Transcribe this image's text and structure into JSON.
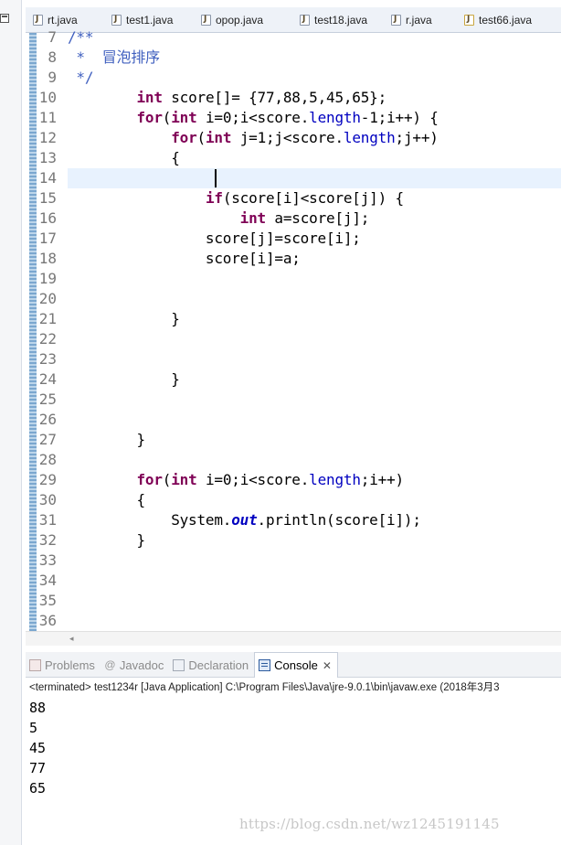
{
  "editor": {
    "tabs": [
      {
        "label": "rt.java",
        "icon": "java-file-icon"
      },
      {
        "label": "test1.java",
        "icon": "java-file-icon"
      },
      {
        "label": "opop.java",
        "icon": "java-file-icon"
      },
      {
        "label": "test18.java",
        "icon": "java-file-icon"
      },
      {
        "label": "r.java",
        "icon": "java-file-icon"
      },
      {
        "label": "test66.java",
        "icon": "java-file-warning-icon"
      }
    ],
    "current_line": 14,
    "lines": [
      {
        "n": "7",
        "tokens": [
          {
            "t": "/**",
            "c": "cm"
          }
        ]
      },
      {
        "n": "8",
        "tokens": [
          {
            "t": " *  冒泡排序",
            "c": "cm"
          }
        ]
      },
      {
        "n": "9",
        "tokens": [
          {
            "t": " */",
            "c": "cm"
          }
        ]
      },
      {
        "n": "10",
        "tokens": [
          {
            "t": "        ",
            "c": ""
          },
          {
            "t": "int",
            "c": "kw"
          },
          {
            "t": " score[]= {77,88,5,45,65};",
            "c": ""
          }
        ]
      },
      {
        "n": "11",
        "tokens": [
          {
            "t": "        ",
            "c": ""
          },
          {
            "t": "for",
            "c": "kw"
          },
          {
            "t": "(",
            "c": ""
          },
          {
            "t": "int",
            "c": "kw"
          },
          {
            "t": " i=0;i<score.",
            "c": ""
          },
          {
            "t": "length",
            "c": "fld"
          },
          {
            "t": "-1;i++) {",
            "c": ""
          }
        ]
      },
      {
        "n": "12",
        "tokens": [
          {
            "t": "            ",
            "c": ""
          },
          {
            "t": "for",
            "c": "kw"
          },
          {
            "t": "(",
            "c": ""
          },
          {
            "t": "int",
            "c": "kw"
          },
          {
            "t": " j=1;j<score.",
            "c": ""
          },
          {
            "t": "length",
            "c": "fld"
          },
          {
            "t": ";j++)",
            "c": ""
          }
        ]
      },
      {
        "n": "13",
        "tokens": [
          {
            "t": "            {",
            "c": ""
          }
        ]
      },
      {
        "n": "14",
        "tokens": []
      },
      {
        "n": "15",
        "tokens": [
          {
            "t": "                ",
            "c": ""
          },
          {
            "t": "if",
            "c": "kw"
          },
          {
            "t": "(score[i]<score[j]) {",
            "c": ""
          }
        ]
      },
      {
        "n": "16",
        "tokens": [
          {
            "t": "                    ",
            "c": ""
          },
          {
            "t": "int",
            "c": "kw"
          },
          {
            "t": " a=score[j];",
            "c": ""
          }
        ]
      },
      {
        "n": "17",
        "tokens": [
          {
            "t": "                score[j]=score[i];",
            "c": ""
          }
        ]
      },
      {
        "n": "18",
        "tokens": [
          {
            "t": "                score[i]=a;",
            "c": ""
          }
        ]
      },
      {
        "n": "19",
        "tokens": []
      },
      {
        "n": "20",
        "tokens": []
      },
      {
        "n": "21",
        "tokens": [
          {
            "t": "            }",
            "c": ""
          }
        ]
      },
      {
        "n": "22",
        "tokens": []
      },
      {
        "n": "23",
        "tokens": []
      },
      {
        "n": "24",
        "tokens": [
          {
            "t": "            }",
            "c": ""
          }
        ]
      },
      {
        "n": "25",
        "tokens": []
      },
      {
        "n": "26",
        "tokens": []
      },
      {
        "n": "27",
        "tokens": [
          {
            "t": "        }",
            "c": ""
          }
        ]
      },
      {
        "n": "28",
        "tokens": []
      },
      {
        "n": "29",
        "tokens": [
          {
            "t": "        ",
            "c": ""
          },
          {
            "t": "for",
            "c": "kw"
          },
          {
            "t": "(",
            "c": ""
          },
          {
            "t": "int",
            "c": "kw"
          },
          {
            "t": " i=0;i<score.",
            "c": ""
          },
          {
            "t": "length",
            "c": "fld"
          },
          {
            "t": ";i++)",
            "c": ""
          }
        ]
      },
      {
        "n": "30",
        "tokens": [
          {
            "t": "        {",
            "c": ""
          }
        ]
      },
      {
        "n": "31",
        "tokens": [
          {
            "t": "            System.",
            "c": ""
          },
          {
            "t": "out",
            "c": "sfld"
          },
          {
            "t": ".println(score[i]);",
            "c": ""
          }
        ]
      },
      {
        "n": "32",
        "tokens": [
          {
            "t": "        }",
            "c": ""
          }
        ]
      },
      {
        "n": "33",
        "tokens": []
      },
      {
        "n": "34",
        "tokens": []
      },
      {
        "n": "35",
        "tokens": []
      },
      {
        "n": "36",
        "tokens": []
      }
    ]
  },
  "views": {
    "tabs": [
      {
        "label": "Problems",
        "icon": "problems-icon",
        "active": false
      },
      {
        "label": "Javadoc",
        "icon": "javadoc-icon",
        "active": false
      },
      {
        "label": "Declaration",
        "icon": "declaration-icon",
        "active": false
      },
      {
        "label": "Console",
        "icon": "console-icon",
        "active": true
      }
    ]
  },
  "console": {
    "status": "<terminated> test1234r [Java Application] C:\\Program Files\\Java\\jre-9.0.1\\bin\\javaw.exe (2018年3月3",
    "output": [
      "88",
      "5",
      "45",
      "77",
      "65"
    ]
  },
  "watermark": "https://blog.csdn.net/wz1245191145",
  "colors": {
    "keyword": "#7f0055",
    "comment": "#3f5fbf",
    "field": "#0000c0",
    "current_line": "#e8f2fe"
  }
}
